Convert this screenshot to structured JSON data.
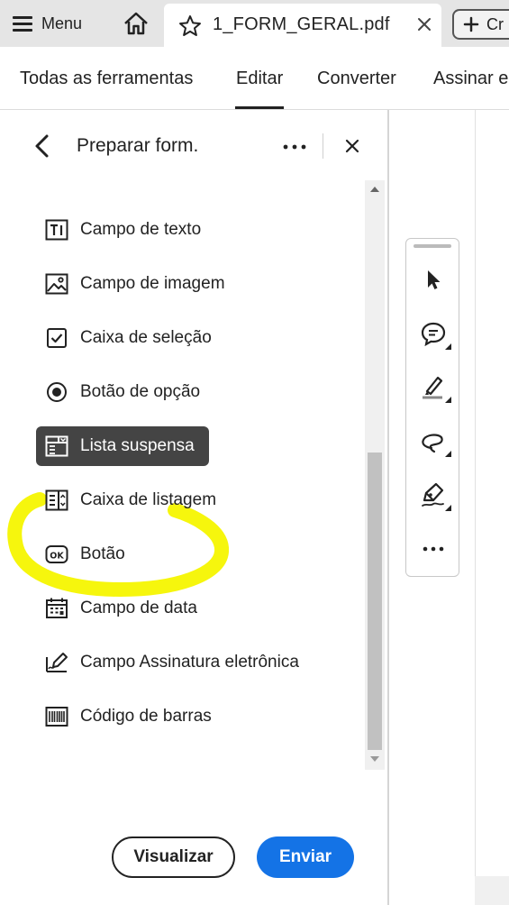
{
  "tabbar": {
    "menu_label": "Menu",
    "home_icon": "home-icon",
    "doc_tab": {
      "title": "1_FORM_GERAL.pdf",
      "star_icon": "star-icon",
      "close_icon": "close-icon"
    },
    "new_tab_label": "Cr"
  },
  "tools": {
    "items": [
      "Todas as ferramentas",
      "Editar",
      "Converter",
      "Assinar e"
    ],
    "active": "Editar"
  },
  "panel": {
    "title": "Preparar form.",
    "fields": [
      {
        "label": "Campo de texto",
        "icon": "text-field-icon"
      },
      {
        "label": "Campo de imagem",
        "icon": "image-field-icon"
      },
      {
        "label": "Caixa de seleção",
        "icon": "checkbox-icon"
      },
      {
        "label": "Botão de opção",
        "icon": "radio-button-icon"
      },
      {
        "label": "Lista suspensa",
        "icon": "dropdown-list-icon",
        "selected": true
      },
      {
        "label": "Caixa de listagem",
        "icon": "list-box-icon"
      },
      {
        "label": "Botão",
        "icon": "ok-button-icon"
      },
      {
        "label": "Campo de data",
        "icon": "calendar-icon"
      },
      {
        "label": "Campo Assinatura eletrônica",
        "icon": "e-signature-icon"
      },
      {
        "label": "Código de barras",
        "icon": "barcode-icon"
      }
    ],
    "preview_label": "Visualizar",
    "send_label": "Enviar"
  },
  "floating_toolbar": {
    "tools": [
      "select-pointer-icon",
      "comment-icon",
      "highlight-pen-icon",
      "draw-lasso-icon",
      "sign-pen-icon",
      "more-icon"
    ]
  },
  "colors": {
    "accent_blue": "#1473e6",
    "selected_item_bg": "#444444",
    "highlight_marker": "#f5f500",
    "tabbar_bg": "#e5e5e5"
  }
}
